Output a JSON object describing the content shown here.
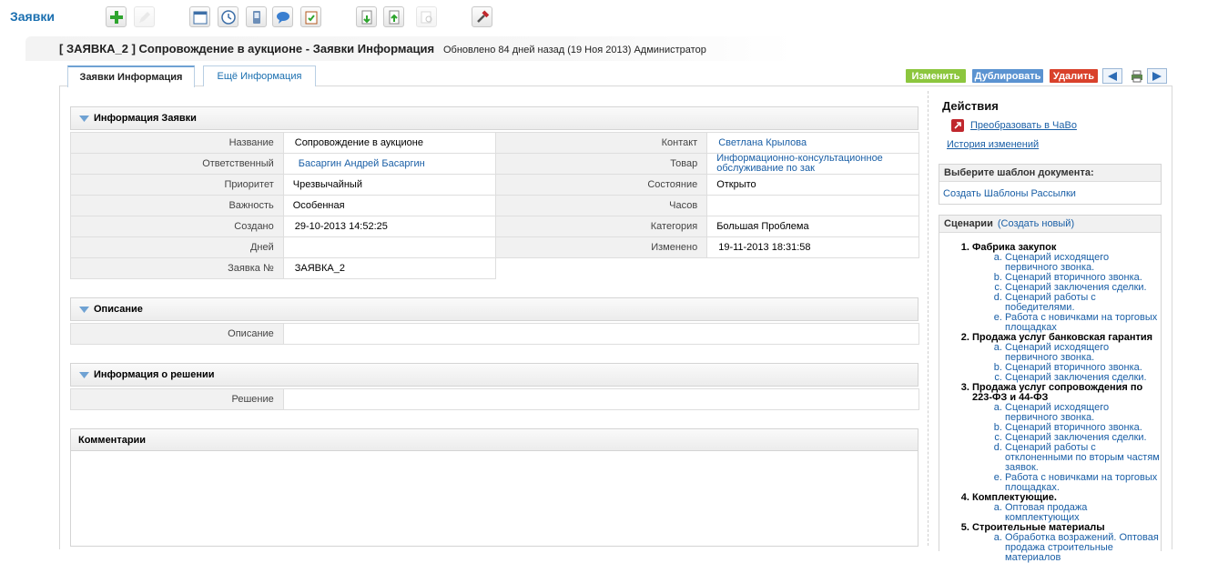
{
  "module": {
    "title": "Заявки"
  },
  "header": {
    "record_title": "[ ЗАЯВКА_2 ] Сопровождение в аукционе - Заявки Информация",
    "updated_info": "Обновлено 84 дней назад (19 Ноя 2013) Администратор"
  },
  "tabs": [
    {
      "label": "Заявки Информация"
    },
    {
      "label": "Ещё Информация"
    }
  ],
  "actions": {
    "edit": "Изменить",
    "duplicate": "Дублировать",
    "delete": "Удалить"
  },
  "sections": {
    "info": "Информация Заявки",
    "description": "Описание",
    "solution": "Информация о решении",
    "comments": "Комментарии"
  },
  "fields": {
    "name_label": "Название",
    "name_value": "Сопровождение в аукционе",
    "contact_label": "Контакт",
    "contact_value": "Светлана Крылова",
    "assigned_label": "Ответственный",
    "assigned_value": "Басаргин Андрей Басаргин",
    "product_label": "Товар",
    "product_value": "Информационно-консультационное обслуживание по зак",
    "priority_label": "Приоритет",
    "priority_value": "Чрезвычайный",
    "status_label": "Состояние",
    "status_value": "Открыто",
    "severity_label": "Важность",
    "severity_value": "Особенная",
    "hours_label": "Часов",
    "hours_value": "",
    "created_label": "Создано",
    "created_value": "29-10-2013 14:52:25",
    "category_label": "Категория",
    "category_value": "Большая Проблема",
    "days_label": "Дней",
    "days_value": "",
    "modified_label": "Изменено",
    "modified_value": "19-11-2013 18:31:58",
    "ticket_no_label": "Заявка №",
    "ticket_no_value": "ЗАЯВКА_2",
    "description_label": "Описание",
    "description_value": "",
    "solution_label": "Решение",
    "solution_value": ""
  },
  "sidebar": {
    "actions_title": "Действия",
    "convert_link": "Преобразовать в ЧаВо",
    "history_link": "История изменений",
    "template_head": "Выберите шаблон документа:",
    "template_link": "Создать Шаблоны Рассылки",
    "scenarios_head": "Сценарии",
    "scenarios_create": "(Создать новый)",
    "scenarios": [
      {
        "title": "Фабрика закупок",
        "items": [
          "Сценарий исходящего первичного звонка.",
          "Сценарий вторичного звонка.",
          "Сценарий заключения сделки.",
          "Сценарий работы с победителями.",
          "Работа с новичками на торговых площадках"
        ]
      },
      {
        "title": "Продажа услуг банковская гарантия",
        "items": [
          "Сценарий исходящего первичного звонка.",
          "Сценарий вторичного звонка.",
          "Сценарий заключения сделки."
        ]
      },
      {
        "title": "Продажа услуг сопровождения по 223-ФЗ и 44-ФЗ",
        "items": [
          "Сценарий исходящего первичного звонка.",
          "Сценарий вторичного звонка.",
          "Сценарий заключения сделки.",
          "Сценарий работы с отклоненными по вторым частям заявок.",
          "Работа с новичками на торговых площадках."
        ]
      },
      {
        "title": "Комплектующие.",
        "items": [
          "Оптовая продажа комплектующих"
        ]
      },
      {
        "title": "Строительные материалы",
        "items": [
          "Обработка возражений. Оптовая продажа строительные материалов"
        ]
      }
    ]
  },
  "colors": {
    "edit": "#8cc63e",
    "duplicate": "#5b93d1",
    "delete": "#d9412b",
    "link": "#1a5fa6"
  },
  "icons": [
    "add-icon",
    "edit-disabled-icon",
    "calendar-icon",
    "clock-icon",
    "phone-icon",
    "chat-icon",
    "clipboard-icon",
    "import-icon",
    "export-icon",
    "find-duplicates-icon",
    "settings-hammer-icon",
    "prev-icon",
    "print-icon",
    "next-icon",
    "convert-icon"
  ]
}
